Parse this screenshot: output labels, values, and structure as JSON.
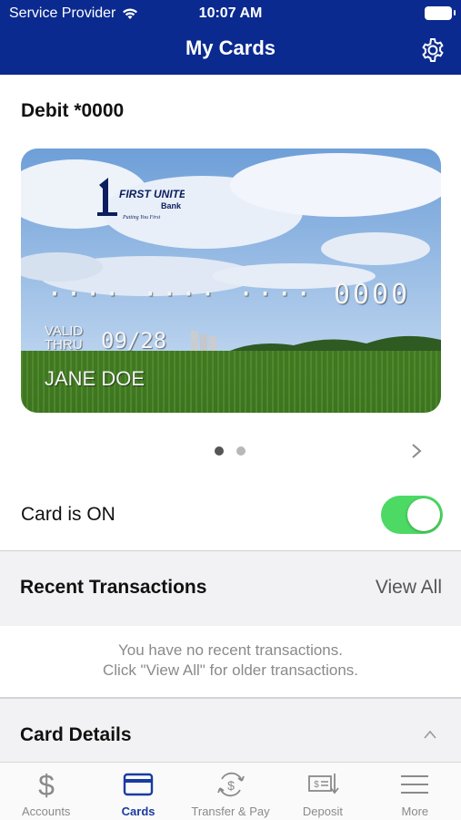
{
  "status_bar": {
    "carrier": "Service Provider",
    "time": "10:07 AM"
  },
  "header": {
    "title": "My Cards"
  },
  "account": {
    "label": "Debit *0000"
  },
  "card": {
    "bank_logo_text": "FIRST UNITED Bank",
    "tagline": "Putting You First",
    "masked_digits": "···· ···· ····",
    "last_four": "0000",
    "valid_label_1": "VALID",
    "valid_label_2": "THRU",
    "expiry": "09/28",
    "holder": "JANE DOE"
  },
  "pager": {
    "total": 2,
    "active_index": 0
  },
  "card_status": {
    "label": "Card is ON",
    "on": true
  },
  "recent_transactions": {
    "title": "Recent Transactions",
    "view_all": "View All",
    "empty_line_1": "You have no recent transactions.",
    "empty_line_2": "Click \"View All\" for older transactions."
  },
  "card_details": {
    "title": "Card Details"
  },
  "tabbar": {
    "tabs": [
      {
        "label": "Accounts",
        "icon": "dollar-icon",
        "active": false
      },
      {
        "label": "Cards",
        "icon": "card-icon",
        "active": true
      },
      {
        "label": "Transfer & Pay",
        "icon": "transfer-icon",
        "active": false
      },
      {
        "label": "Deposit",
        "icon": "check-deposit-icon",
        "active": false
      },
      {
        "label": "More",
        "icon": "menu-icon",
        "active": false
      }
    ]
  },
  "colors": {
    "header_bg": "#0a2a8f",
    "toggle_on": "#4cd964",
    "active_tab": "#1a3ba0"
  }
}
